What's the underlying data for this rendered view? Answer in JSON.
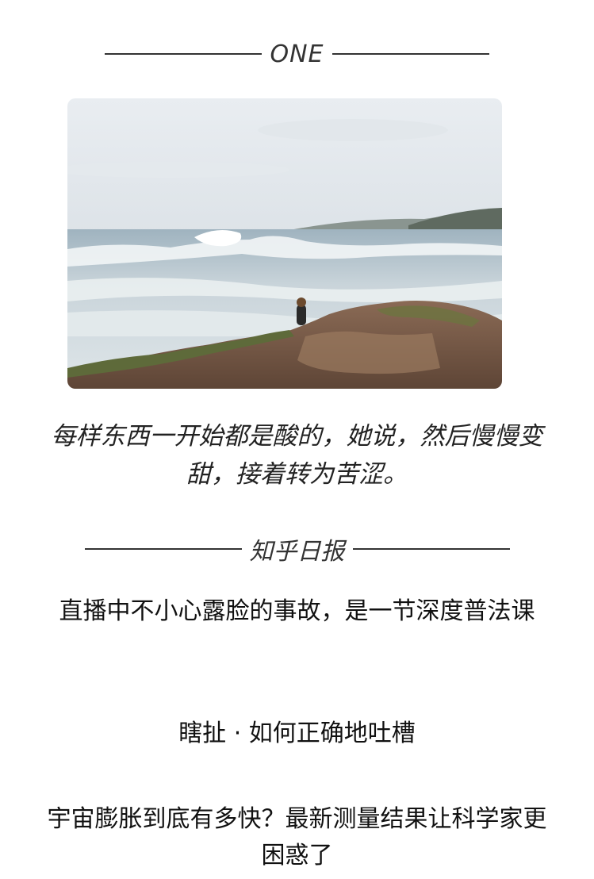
{
  "one_section": {
    "label": "ONE",
    "quote": "每样东西一开始都是酸的，她说，然后慢慢变甜，接着转为苦涩。"
  },
  "zhihu_section": {
    "label": "知乎日报",
    "articles": [
      {
        "title": "直播中不小心露脸的事故，是一节深度普法课"
      },
      {
        "title": "瞎扯 · 如何正确地吐槽"
      },
      {
        "title": "宇宙膨胀到底有多快？最新测量结果让科学家更困惑了"
      }
    ]
  },
  "colors": {
    "text": "#222222",
    "divider": "#333333",
    "background": "#ffffff"
  }
}
